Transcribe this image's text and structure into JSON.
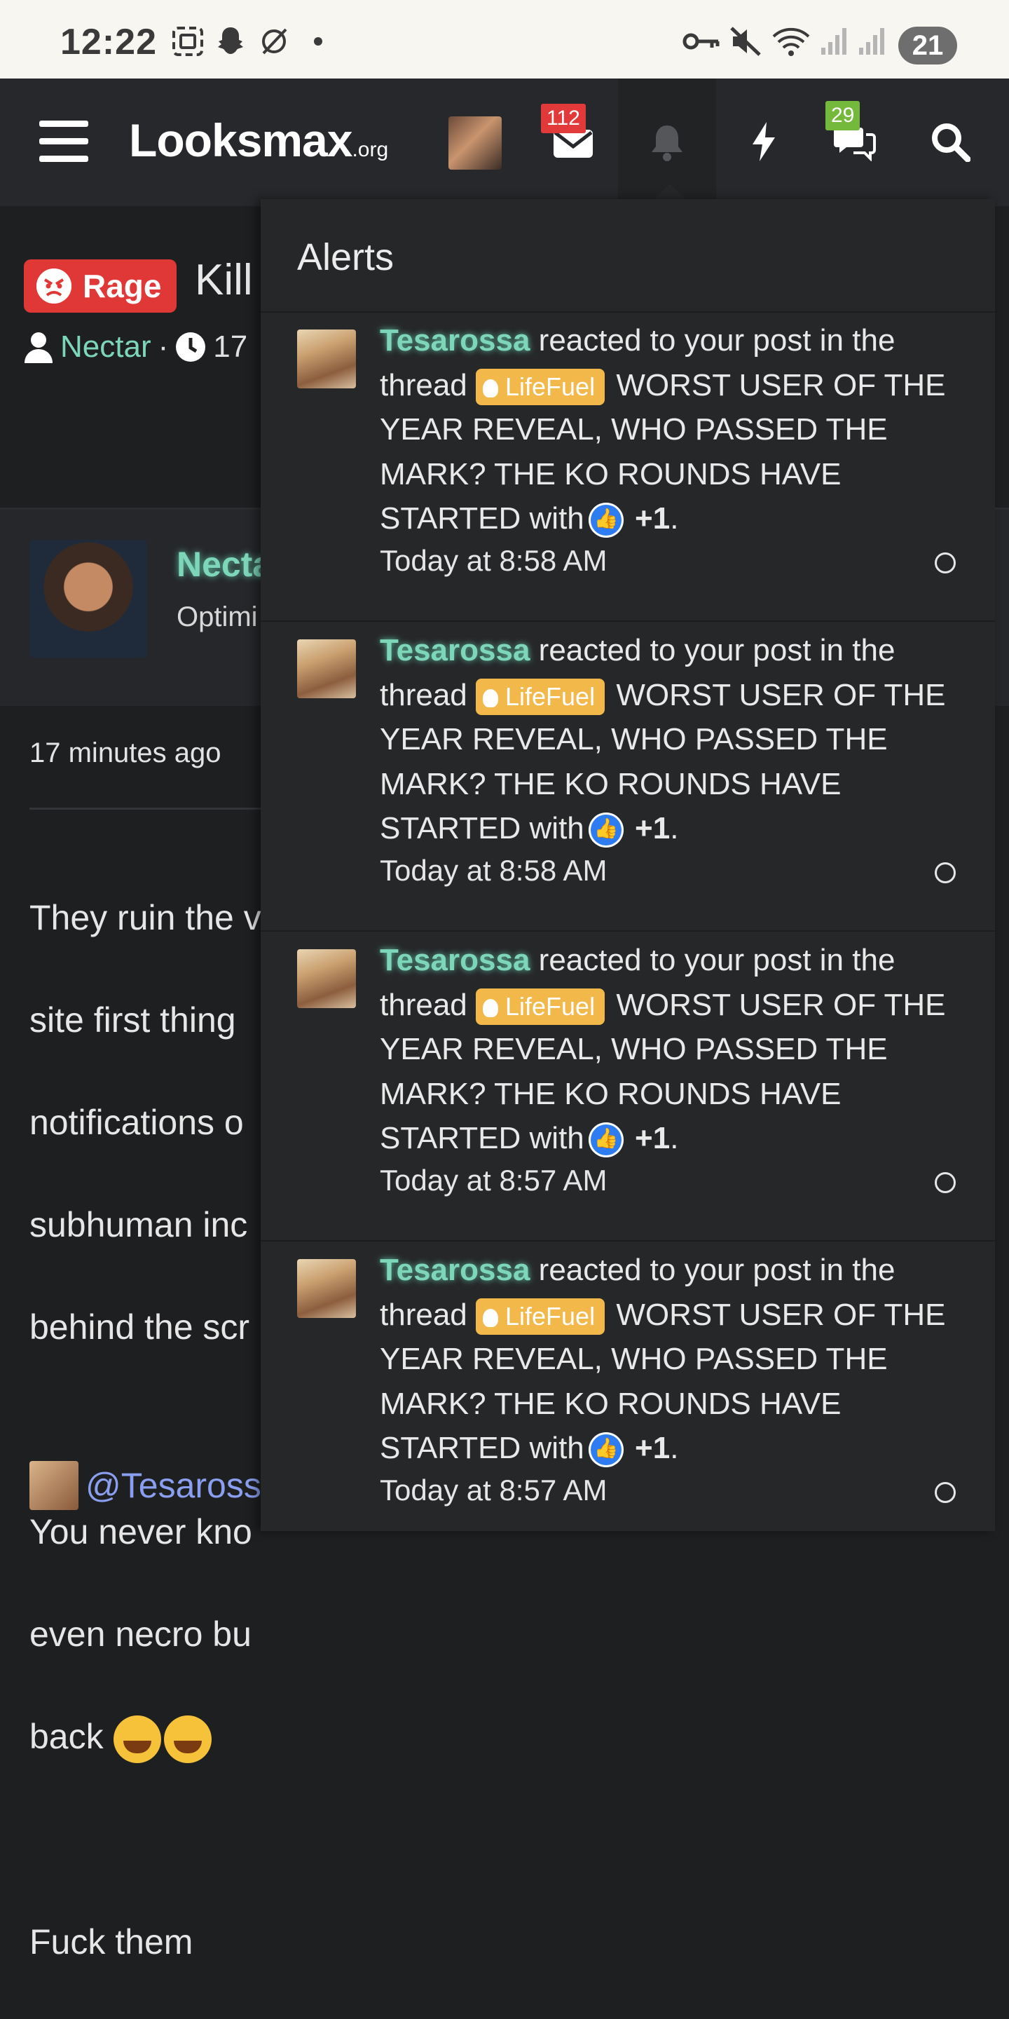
{
  "status_bar": {
    "time": "12:22",
    "battery": "21",
    "icons": [
      "screenshot-icon",
      "snapchat-icon",
      "no-sync-icon",
      "dot-icon",
      "vpn-key-icon",
      "mute-icon",
      "wifi-icon",
      "signal-icon",
      "signal-icon"
    ]
  },
  "header": {
    "logo_main": "Looksmax",
    "logo_suffix": ".org",
    "inbox_count": "112",
    "chat_count": "29",
    "icons": [
      "menu-icon",
      "avatar",
      "inbox-icon",
      "bell-icon",
      "bolt-icon",
      "chat-icon",
      "search-icon"
    ]
  },
  "thread": {
    "prefix_label": "Rage",
    "title_fragment": "Kill",
    "author": "Nectar",
    "meta_sep": "·",
    "age_fragment": "17"
  },
  "post": {
    "author_fragment": "Necta",
    "role_fragment": "Optimi",
    "time": "17 minutes ago",
    "body_lines": [
      "They ruin the v",
      "site first thing",
      "notifications o",
      "subhuman inc",
      "behind the scr",
      "",
      "You never kno",
      "even necro bu",
      "back"
    ],
    "closing": "Fuck them",
    "mention": "@Tesaross"
  },
  "alerts": {
    "title": "Alerts",
    "items": [
      {
        "user": "Tesarossa",
        "action": "reacted to your post in the thread",
        "prefix": "LifeFuel",
        "thread": "WORST USER OF THE YEAR REVEAL, WHO PASSED THE MARK? THE KO ROUNDS HAVE STARTED",
        "with_text": "with",
        "reaction": "+1",
        "end": ".",
        "time": "Today at 8:58 AM"
      },
      {
        "user": "Tesarossa",
        "action": "reacted to your post in the thread",
        "prefix": "LifeFuel",
        "thread": "WORST USER OF THE YEAR REVEAL, WHO PASSED THE MARK? THE KO ROUNDS HAVE STARTED",
        "with_text": "with",
        "reaction": "+1",
        "end": ".",
        "time": "Today at 8:58 AM"
      },
      {
        "user": "Tesarossa",
        "action": "reacted to your post in the thread",
        "prefix": "LifeFuel",
        "thread": "WORST USER OF THE YEAR REVEAL, WHO PASSED THE MARK? THE KO ROUNDS HAVE STARTED",
        "with_text": "with",
        "reaction": "+1",
        "end": ".",
        "time": "Today at 8:57 AM"
      },
      {
        "user": "Tesarossa",
        "action": "reacted to your post in the thread",
        "prefix": "LifeFuel",
        "thread": "WORST USER OF THE YEAR REVEAL, WHO PASSED THE MARK? THE KO ROUNDS HAVE STARTED",
        "with_text": "with",
        "reaction": "+1",
        "end": ".",
        "time": "Today at 8:57 AM"
      }
    ]
  },
  "colors": {
    "accent_username": "#7ed6b8",
    "rage_tag": "#e03737",
    "lifefuel_prefix": "#f3b84a",
    "like_reaction": "#2d7cf2",
    "badge_red": "#e23a3a",
    "badge_green": "#74b93c"
  }
}
